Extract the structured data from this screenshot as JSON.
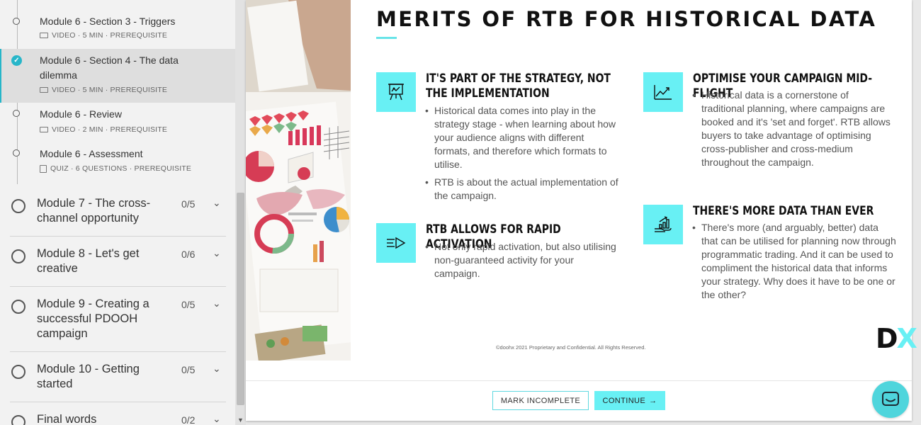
{
  "sidebar": {
    "top_lesson": {
      "title": "Module 6 - Section 3 - Triggers",
      "meta": "VIDEO · 5 MIN · PREREQUISITE"
    },
    "active_lesson": {
      "title": "Module 6 - Section 4 - The data dilemma",
      "meta": "VIDEO · 5 MIN · PREREQUISITE"
    },
    "review_lesson": {
      "title": "Module 6 - Review",
      "meta": "VIDEO · 2 MIN · PREREQUISITE"
    },
    "assessment_lesson": {
      "title": "Module 6 - Assessment",
      "meta": "QUIZ · 6 QUESTIONS · PREREQUISITE"
    },
    "modules": [
      {
        "title": "Module 7 - The cross-channel opportunity",
        "count": "0/5"
      },
      {
        "title": "Module 8 - Let's get creative",
        "count": "0/6"
      },
      {
        "title": "Module 9 - Creating a successful PDOOH campaign",
        "count": "0/5"
      },
      {
        "title": "Module 10 - Getting started",
        "count": "0/5"
      },
      {
        "title": "Final words",
        "count": "0/2"
      }
    ]
  },
  "slide": {
    "title": "MERITS OF RTB FOR HISTORICAL  DATA",
    "features": [
      {
        "icon": "presentation-chart-icon",
        "heading": "IT'S PART OF THE STRATEGY, NOT THE IMPLEMENTATION",
        "bullets": [
          "Historical data comes into play in the strategy stage - when learning about how your audience aligns with different formats, and therefore which formats to utilise.",
          "RTB is about the actual implementation of the campaign."
        ]
      },
      {
        "icon": "fast-arrow-icon",
        "heading": "RTB ALLOWS FOR RAPID ACTIVATION",
        "bullets": [
          "Not only rapid activation, but also utilising non-guaranteed activity for your campaign."
        ]
      },
      {
        "icon": "line-chart-icon",
        "heading": "OPTIMISE YOUR CAMPAIGN MID-FLIGHT",
        "bullets": [
          "Historical data is a cornerstone of traditional planning, where campaigns are booked and it's 'set and forget'. RTB allows buyers to take advantage of optimising cross-publisher and cross-medium throughout the campaign."
        ]
      },
      {
        "icon": "growth-hand-icon",
        "heading": "THERE'S MORE DATA THAN EVER",
        "bullets": [
          "There's more (and arguably, better) data that can be utilised for planning now through programmatic trading. And it can be used to compliment the historical data that informs your strategy. Why does it have to be one or the other?"
        ]
      }
    ],
    "copyright": "©doohx 2021 Proprietary and Confidential. All Rights Reserved.",
    "logo": {
      "d": "D",
      "x": "X"
    }
  },
  "footer": {
    "mark_incomplete": "MARK INCOMPLETE",
    "continue": "CONTINUE",
    "continue_arrow": "→"
  },
  "colors": {
    "accent": "#68f0f4",
    "check": "#27b6c9"
  }
}
